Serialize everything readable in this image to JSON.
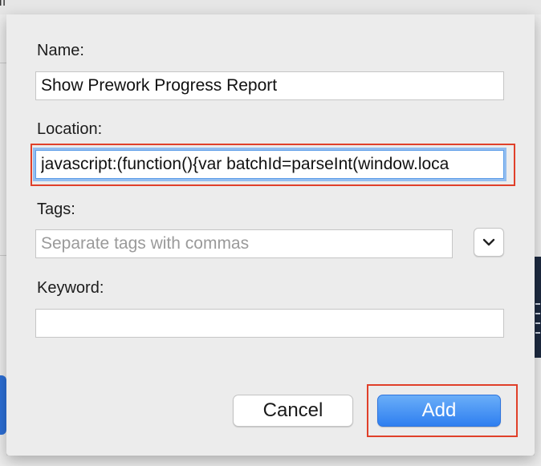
{
  "dialog": {
    "name": {
      "label": "Name:",
      "value": "Show Prework Progress Report"
    },
    "location": {
      "label": "Location:",
      "value": "javascript:(function(){var batchId=parseInt(window.loca"
    },
    "tags": {
      "label": "Tags:",
      "placeholder": "Separate tags with commas",
      "value": ""
    },
    "keyword": {
      "label": "Keyword:",
      "value": ""
    },
    "buttons": {
      "cancel": "Cancel",
      "add": "Add"
    }
  },
  "icons": {
    "tags_dropdown": "chevron-down-icon"
  },
  "colors": {
    "highlight": "#e0402a",
    "focus_ring": "#92bdf0",
    "primary_button": "#2f7ff0",
    "dialog_background": "#ececec"
  }
}
